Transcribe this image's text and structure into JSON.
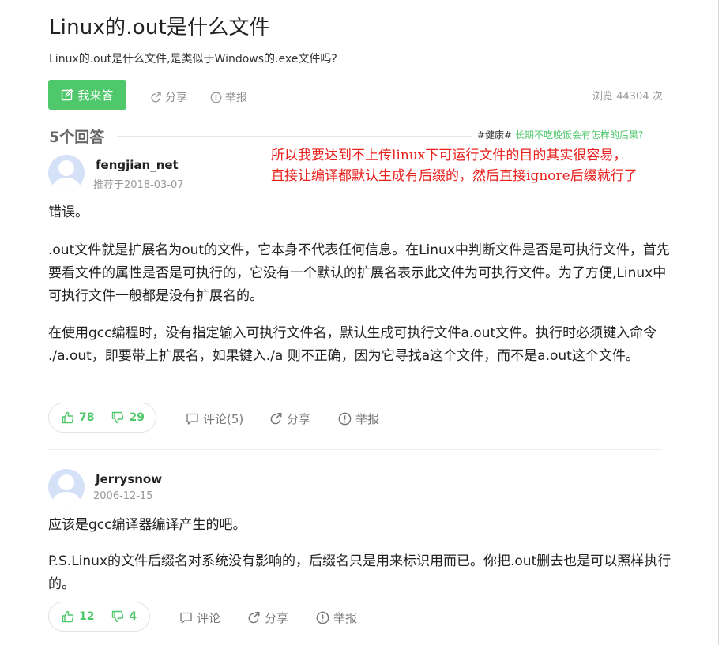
{
  "question": {
    "title": "Linux的.out是什么文件",
    "description": "Linux的.out是什么文件,是类似于Windows的.exe文件吗?",
    "answer_button_label": "我来答",
    "share_label": "分享",
    "report_label": "举报",
    "view_count_text": "浏览 44304 次"
  },
  "answers_header": {
    "count_label": "5个回答",
    "hot_tag": "#健康#",
    "hot_link": "长期不吃晚饭会有怎样的后果?"
  },
  "overlay_note": {
    "line1": "所以我要达到不上传linux下可运行文件的目的其实很容易，",
    "line2": "直接让编译都默认生成有后缀的，然后直接ignore后缀就行了"
  },
  "answers": [
    {
      "username": "fengjian_net",
      "date": "推荐于2018-03-07",
      "paragraphs": [
        "错误。",
        ".out文件就是扩展名为out的文件，它本身不代表任何信息。在Linux中判断文件是否是可执行文件，首先要看文件的属性是否是可执行的，它没有一个默认的扩展名表示此文件为可执行文件。为了方便,Linux中可执行文件一般都是没有扩展名的。",
        "在使用gcc编程时，没有指定输入可执行文件名，默认生成可执行文件a.out文件。执行时必须键入命令 ./a.out，即要带上扩展名，如果键入./a 则不正确，因为它寻找a这个文件，而不是a.out这个文件。"
      ],
      "upvotes": "78",
      "downvotes": "29",
      "comment_label": "评论(5)",
      "share_label": "分享",
      "report_label": "举报"
    },
    {
      "username": "Jerrysnow",
      "date": "2006-12-15",
      "paragraphs": [
        "应该是gcc编译器编译产生的吧。",
        "P.S.Linux的文件后缀名对系统没有影响的，后缀名只是用来标识用而已。你把.out删去也是可以照样执行的。"
      ],
      "upvotes": "12",
      "downvotes": "4",
      "comment_label": "评论",
      "share_label": "分享",
      "report_label": "举报"
    }
  ],
  "colors": {
    "accent_green": "#4fc76b",
    "overlay_red": "#e8211d",
    "muted_text": "#999999"
  },
  "icons": [
    "edit-icon",
    "share-icon",
    "report-icon",
    "thumbs-up-icon",
    "thumbs-down-icon",
    "comment-icon",
    "avatar-icon"
  ]
}
